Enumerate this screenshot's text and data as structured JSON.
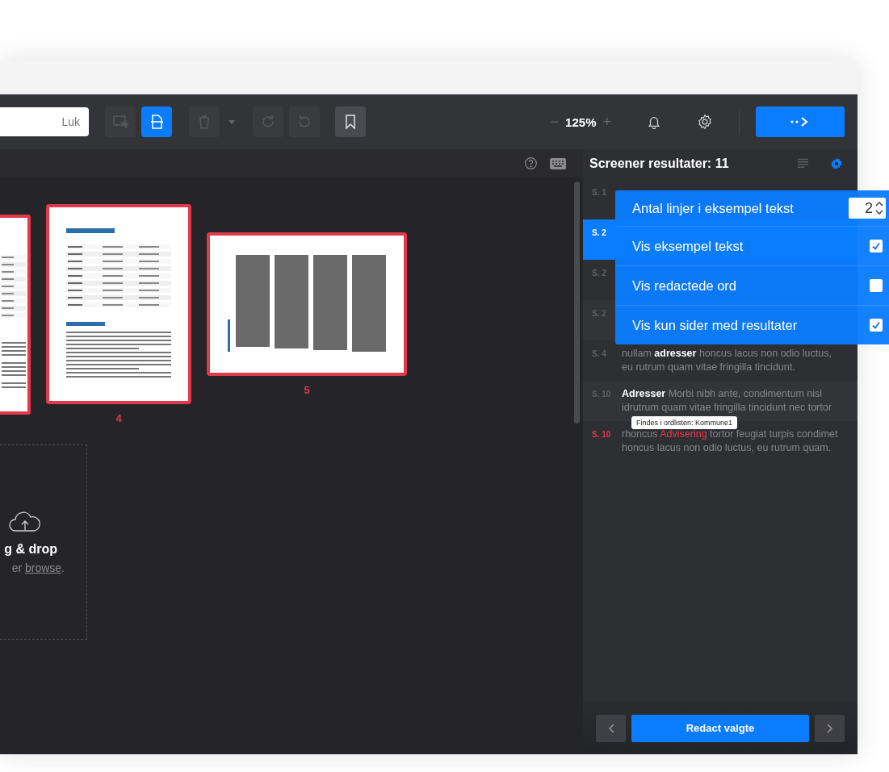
{
  "toolbar": {
    "search": {
      "close_label": "Luk"
    },
    "tools": [
      {
        "kind": "select",
        "selected": false,
        "disabled": true
      },
      {
        "kind": "page",
        "selected": true,
        "disabled": false
      },
      {
        "kind": "trash",
        "selected": false,
        "disabled": true
      },
      {
        "kind": "redo",
        "selected": false,
        "disabled": true
      },
      {
        "kind": "undo",
        "selected": false,
        "disabled": true
      },
      {
        "kind": "bookmark",
        "selected": false,
        "disabled": false
      }
    ],
    "zoom": {
      "minus": "−",
      "value": "125%",
      "plus": "+"
    }
  },
  "canvas": {
    "thumbnails": [
      {
        "kind": "portrait",
        "flagged": true
      },
      {
        "kind": "portrait",
        "flagged": true,
        "label": "4"
      },
      {
        "kind": "landscape",
        "flagged": true,
        "label": "5"
      }
    ],
    "drop_zone": {
      "title": "g & drop",
      "hint_prefix": "er",
      "link": "browse",
      "hint_suffix": "."
    }
  },
  "panel": {
    "title": "Screener resultater: 11",
    "results": [
      {
        "page": "S. 1",
        "selected": false,
        "flagged": false
      },
      {
        "page": "S. 2",
        "selected": true,
        "flagged": false
      },
      {
        "page": "S. 2",
        "selected": false,
        "flagged": false
      },
      {
        "page": "S. 2",
        "selected": false,
        "flagged": false
      },
      {
        "page": "S. 4",
        "selected": false,
        "flagged": false,
        "pre": "nullam ",
        "match": "adresser",
        "post": " honcus lacus non odio luctus, eu rutrum quam vitae fringilla tincidunt."
      },
      {
        "page": "S. 10",
        "selected": false,
        "flagged": false,
        "match": "Adresser",
        "post": " Morbi nibh ante, condimentum nisl idrutrum quam vitae fringilla tincidunt nec tortor"
      },
      {
        "page": "S. 10",
        "selected": false,
        "flagged": true,
        "pre": "rhoncus ",
        "match": "Advisering",
        "post": " tortor feugiat turpis condimet honcus lacus non odio luctus, eu rutrum quam.",
        "tooltip": "Findes i ordlisten: Kommune1"
      }
    ],
    "footer": {
      "action": "Redact valgte"
    }
  },
  "settings": {
    "rows": [
      {
        "kind": "number",
        "label": "Antal linjer i eksempel tekst",
        "value": "2"
      },
      {
        "kind": "checkbox",
        "label": "Vis eksempel tekst",
        "checked": true
      },
      {
        "kind": "checkbox",
        "label": "Vis redactede ord",
        "checked": false
      },
      {
        "kind": "checkbox",
        "label": "Vis kun sider med resultater",
        "checked": true
      }
    ]
  }
}
